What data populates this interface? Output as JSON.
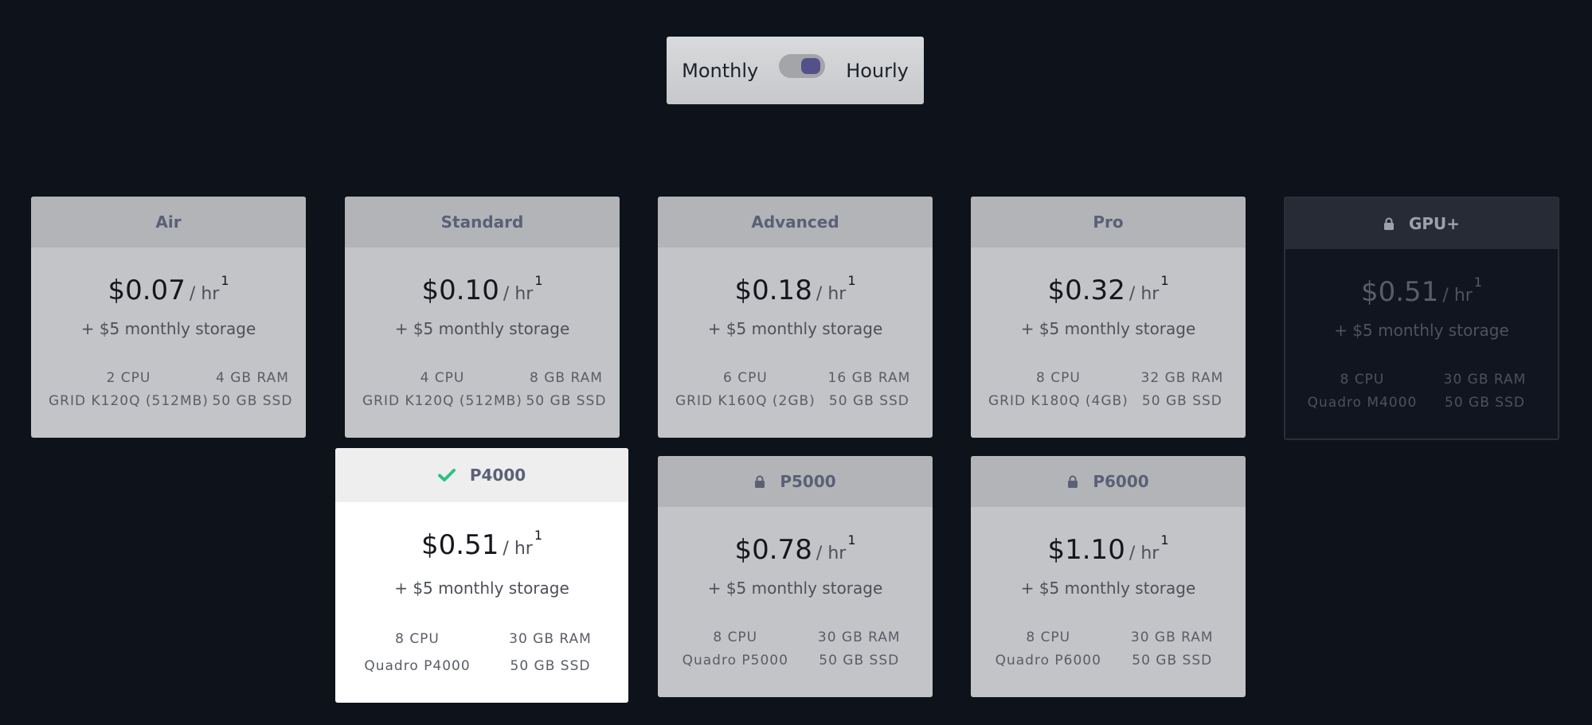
{
  "toggle": {
    "left_label": "Monthly",
    "right_label": "Hourly",
    "selected": "Hourly"
  },
  "plans": [
    {
      "name": "Air",
      "price": "$0.07",
      "unit": "/ hr",
      "note": "1",
      "storage": "+ $5 monthly storage",
      "cpu": "2 CPU",
      "ram": "4 GB RAM",
      "gpu": "GRID K120Q (512MB)",
      "disk": "50 GB SSD"
    },
    {
      "name": "Standard",
      "price": "$0.10",
      "unit": "/ hr",
      "note": "1",
      "storage": "+ $5 monthly storage",
      "cpu": "4 CPU",
      "ram": "8 GB RAM",
      "gpu": "GRID K120Q (512MB)",
      "disk": "50 GB SSD"
    },
    {
      "name": "Advanced",
      "price": "$0.18",
      "unit": "/ hr",
      "note": "1",
      "storage": "+ $5 monthly storage",
      "cpu": "6 CPU",
      "ram": "16 GB RAM",
      "gpu": "GRID K160Q (2GB)",
      "disk": "50 GB SSD"
    },
    {
      "name": "Pro",
      "price": "$0.32",
      "unit": "/ hr",
      "note": "1",
      "storage": "+ $5 monthly storage",
      "cpu": "8 CPU",
      "ram": "32 GB RAM",
      "gpu": "GRID K180Q (4GB)",
      "disk": "50 GB SSD"
    },
    {
      "name": "GPU+",
      "price": "$0.51",
      "unit": "/ hr",
      "note": "1",
      "storage": "+ $5 monthly storage",
      "cpu": "8 CPU",
      "ram": "30 GB RAM",
      "gpu": "Quadro M4000",
      "disk": "50 GB SSD",
      "icon": "lock-icon",
      "locked": true
    },
    {
      "name": "P4000",
      "price": "$0.51",
      "unit": "/ hr",
      "note": "1",
      "storage": "+ $5 monthly storage",
      "cpu": "8 CPU",
      "ram": "30 GB RAM",
      "gpu": "Quadro P4000",
      "disk": "50 GB SSD",
      "icon": "check-icon",
      "selected": true
    },
    {
      "name": "P5000",
      "price": "$0.78",
      "unit": "/ hr",
      "note": "1",
      "storage": "+ $5 monthly storage",
      "cpu": "8 CPU",
      "ram": "30 GB RAM",
      "gpu": "Quadro P5000",
      "disk": "50 GB SSD",
      "icon": "lock-icon",
      "locked": true
    },
    {
      "name": "P6000",
      "price": "$1.10",
      "unit": "/ hr",
      "note": "1",
      "storage": "+ $5 monthly storage",
      "cpu": "8 CPU",
      "ram": "30 GB RAM",
      "gpu": "Quadro P6000",
      "disk": "50 GB SSD",
      "icon": "lock-icon",
      "locked": true
    }
  ],
  "colors": {
    "background": "#0e121a",
    "accent": "#54508a",
    "check": "#2ec27e",
    "header_text": "#5b6076"
  }
}
